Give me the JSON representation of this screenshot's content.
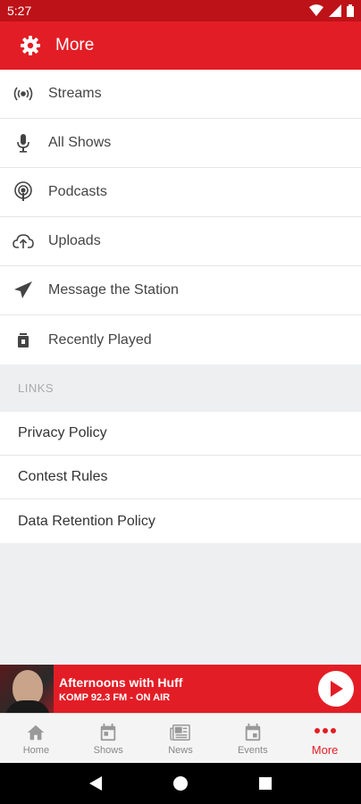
{
  "status_bar": {
    "time": "5:27"
  },
  "app_bar": {
    "title": "More",
    "icon": "gear-icon"
  },
  "menu": [
    {
      "label": "Streams",
      "icon": "broadcast-icon"
    },
    {
      "label": "All Shows",
      "icon": "microphone-icon"
    },
    {
      "label": "Podcasts",
      "icon": "podcast-icon"
    },
    {
      "label": "Uploads",
      "icon": "cloud-upload-icon"
    },
    {
      "label": "Message the Station",
      "icon": "send-icon"
    },
    {
      "label": "Recently Played",
      "icon": "history-icon"
    }
  ],
  "links": {
    "header": "LINKS",
    "items": [
      "Privacy Policy",
      "Contest Rules",
      "Data Retention Policy"
    ]
  },
  "now_playing": {
    "title": "Afternoons with Huff",
    "subtitle": "KOMP 92.3 FM  - ON AIR",
    "button_icon": "play-icon"
  },
  "bottom_nav": [
    {
      "label": "Home",
      "icon": "home-icon",
      "active": false
    },
    {
      "label": "Shows",
      "icon": "calendar-icon",
      "active": false
    },
    {
      "label": "News",
      "icon": "newspaper-icon",
      "active": false
    },
    {
      "label": "Events",
      "icon": "event-icon",
      "active": false
    },
    {
      "label": "More",
      "icon": "more-dots-icon",
      "active": true
    }
  ],
  "colors": {
    "accent": "#e31d25",
    "status_bar": "#bd1218"
  }
}
